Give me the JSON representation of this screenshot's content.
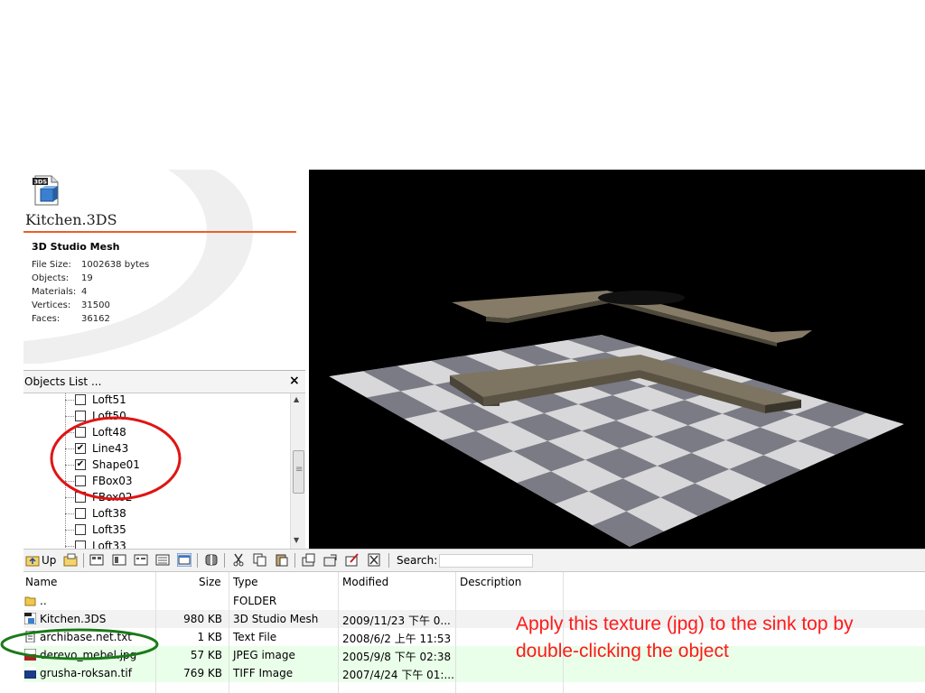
{
  "info_panel": {
    "file_icon_badge": "3DS",
    "file_name": "Kitchen.3DS",
    "file_type": "3D Studio Mesh",
    "properties": [
      {
        "label": "File Size:",
        "value": "1002638 bytes"
      },
      {
        "label": "Objects:",
        "value": "19"
      },
      {
        "label": "Materials:",
        "value": "4"
      },
      {
        "label": "Vertices:",
        "value": "31500"
      },
      {
        "label": "Faces:",
        "value": "36162"
      }
    ],
    "accent_color": "#e8602a"
  },
  "objects_list": {
    "title": "Objects List  ...",
    "close_glyph": "×",
    "items": [
      {
        "label": "Loft51",
        "checked": false
      },
      {
        "label": "Loft50",
        "checked": false
      },
      {
        "label": "Loft48",
        "checked": false
      },
      {
        "label": "Line43",
        "checked": true
      },
      {
        "label": "Shape01",
        "checked": true
      },
      {
        "label": "FBox03",
        "checked": false
      },
      {
        "label": "FBox02",
        "checked": false
      },
      {
        "label": "Loft38",
        "checked": false
      },
      {
        "label": "Loft35",
        "checked": false
      },
      {
        "label": "Loft33",
        "checked": false
      }
    ],
    "check_glyph": "✔",
    "highlight_color": "#e01414"
  },
  "toolbar": {
    "up_label": "Up",
    "search_label": "Search:",
    "search_value": ""
  },
  "file_list": {
    "columns": [
      "Name",
      "Size",
      "Type",
      "Modified",
      "Description"
    ],
    "rows": [
      {
        "name": "..",
        "size": "",
        "type": "FOLDER",
        "modified": "",
        "icon": "folder-icon",
        "bg": "#ffffff"
      },
      {
        "name": "Kitchen.3DS",
        "size": "980 KB",
        "type": "3D Studio Mesh",
        "modified": "2009/11/23 下午 0...",
        "icon": "3ds-file-icon",
        "bg": "#f2f2f2"
      },
      {
        "name": "archibase.net.txt",
        "size": "1 KB",
        "type": "Text File",
        "modified": "2008/6/2 上午 11:53",
        "icon": "text-file-icon",
        "bg": "#ffffff"
      },
      {
        "name": "derevo_mebel.jpg",
        "size": "57 KB",
        "type": "JPEG image",
        "modified": "2005/9/8 下午 02:38",
        "icon": "jpg-file-icon",
        "bg": "#eaffea"
      },
      {
        "name": "grusha-roksan.tif",
        "size": "769 KB",
        "type": "TIFF Image",
        "modified": "2007/4/24 下午 01:...",
        "icon": "tif-file-icon",
        "bg": "#eaffea"
      }
    ],
    "highlight_color": "#1a7a1a"
  },
  "annotation": {
    "text": "Apply this texture (jpg) to the sink top by double-clicking the object",
    "color": "#ff1a1a"
  }
}
